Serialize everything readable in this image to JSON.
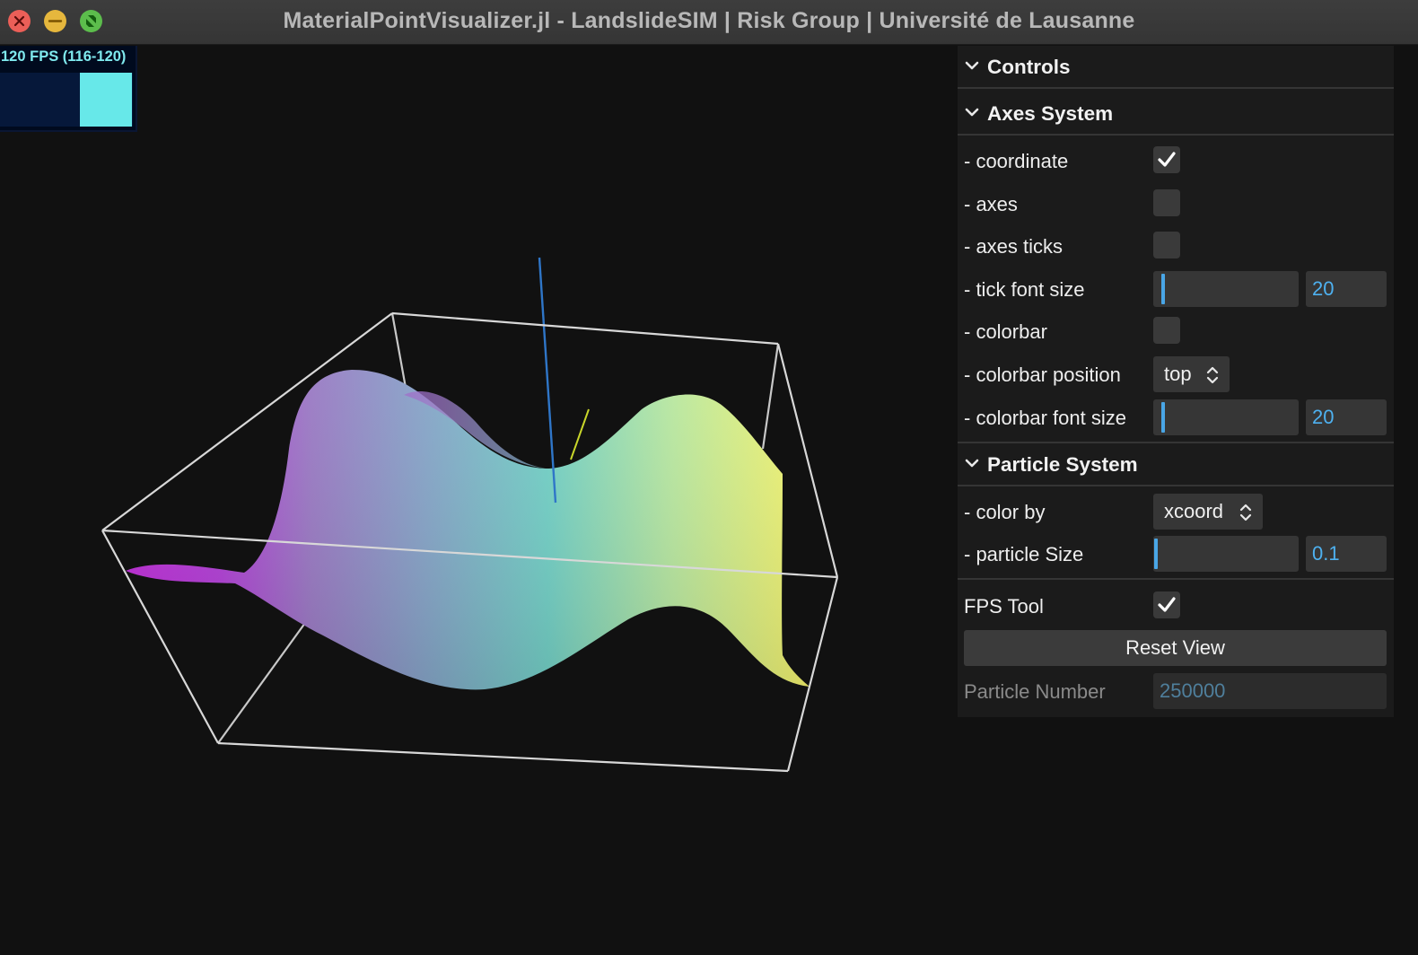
{
  "window": {
    "title": "MaterialPointVisualizer.jl - LandslideSIM | Risk Group | Université de Lausanne"
  },
  "fps": {
    "label": "120 FPS (116-120)"
  },
  "panel": {
    "controls_header": "Controls",
    "axes_header": "Axes System",
    "axes_rows": {
      "coordinate": {
        "label": "- coordinate",
        "checked": true
      },
      "axes": {
        "label": "- axes",
        "checked": false
      },
      "axes_ticks": {
        "label": "- axes ticks",
        "checked": false
      },
      "tick_font_size": {
        "label": "- tick font size",
        "value": "20"
      },
      "colorbar": {
        "label": "- colorbar",
        "checked": false
      },
      "colorbar_position": {
        "label": "- colorbar position",
        "value": "top"
      },
      "colorbar_font_size": {
        "label": "- colorbar font size",
        "value": "20"
      }
    },
    "particle_header": "Particle System",
    "particle_rows": {
      "color_by": {
        "label": "- color by",
        "value": "xcoord"
      },
      "particle_size": {
        "label": "- particle Size",
        "value": "0.1"
      }
    },
    "fps_tool": {
      "label": "FPS Tool",
      "checked": true
    },
    "reset_view": "Reset View",
    "particle_number": {
      "label": "Particle Number",
      "value": "250000"
    }
  },
  "colors": {
    "accent": "#4eb1f0",
    "slider_grab": "#49a6e6",
    "colormap_low": "#b12ad6",
    "colormap_mid": "#6fd1c4",
    "colormap_high": "#f7f56a"
  },
  "icons": [
    "close-icon",
    "minimize-icon",
    "fullscreen-icon",
    "chevron-down-icon",
    "checkmark-icon",
    "updown-arrows-icon"
  ]
}
